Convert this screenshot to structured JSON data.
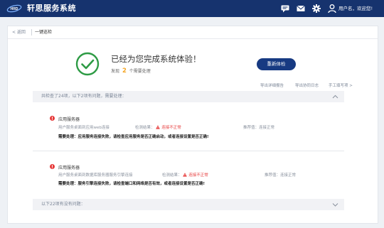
{
  "header": {
    "logo_text": "HRD SHARE",
    "title": "轩思服务系统",
    "icons": [
      "chat-icon",
      "mail-icon",
      "gear-icon",
      "user-icon"
    ],
    "user_greeting": "用户名，欢迎您!"
  },
  "breadcrumb": {
    "back_label": "< 返回",
    "current": "一键巡检"
  },
  "summary": {
    "title": "已经为您完成系统体验！",
    "sub_prefix": "发现",
    "issue_count": "2",
    "sub_suffix": "个需要处理",
    "retest_label": "重新体检"
  },
  "links": {
    "export_report": "导出详细报告",
    "export_log": "导出协同日志",
    "manual_fill": "手工填写项 >"
  },
  "section_issues": {
    "header": "共检查了24项，以下2项有问题，需要处理："
  },
  "issues": [
    {
      "title": "应用服务器",
      "item": "用户服务桌面到应用web连接",
      "result_label": "检测结果：",
      "result_value": "连接不正常",
      "recommend_label": "推荐值：",
      "recommend_value": "连接正常",
      "fix": "需要处理：应用服务连接失败，请检查应用服务是否正确启动，或者连接设置是否正确!"
    },
    {
      "title": "应用服务器",
      "item": "用户服务桌面到数据库服务器服务引擎连接",
      "result_label": "检测结果：",
      "result_value": "连接不正常",
      "recommend_label": "推荐值：",
      "recommend_value": "连接正常",
      "fix": "需要处理：服务引擎连接失败，请检查端口和网络是否有效，或者连接设置是否正确!"
    }
  ],
  "section_ok": {
    "header": "以下22项有没有问题："
  },
  "colors": {
    "header_bg": "#16336e",
    "button_bg": "#173a82",
    "success_green": "#2e9b45",
    "error_red": "#e63a3a",
    "count_orange": "#f5a623"
  }
}
